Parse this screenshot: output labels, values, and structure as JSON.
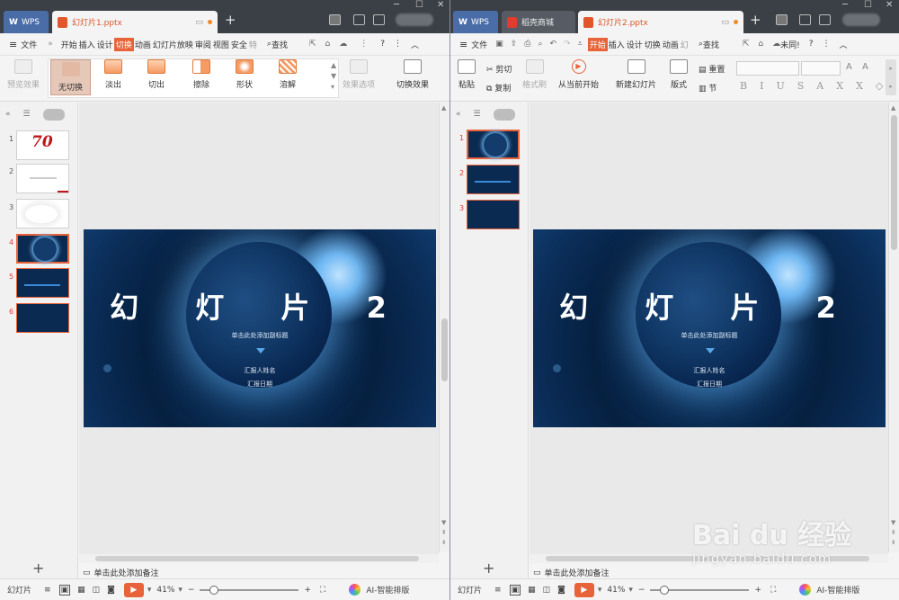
{
  "left_window": {
    "tabs": {
      "wps": "WPS",
      "file": "幻灯片1.pptx"
    },
    "menu": {
      "file": "文件",
      "items": [
        "开始",
        "插入",
        "设计",
        "切换",
        "动画",
        "幻灯片放映",
        "审阅",
        "视图",
        "安全",
        "特"
      ],
      "active": "切换",
      "search": "查找"
    },
    "ribbon": {
      "preview": "预览效果",
      "transitions": [
        "无切换",
        "淡出",
        "切出",
        "擦除",
        "形状",
        "溶解"
      ],
      "effect_options": "效果选项",
      "switch_effect": "切换效果"
    },
    "thumbnails": [
      "1",
      "2",
      "3",
      "4",
      "5",
      "6"
    ],
    "selected_thumbnail": "4",
    "slide": {
      "title": "幻 灯 片 2",
      "subtitle": "单击此处添加副标题",
      "reporter": "汇报人姓名",
      "date": "汇报日期"
    },
    "notes": "单击此处添加备注",
    "status": {
      "label": "幻灯片",
      "zoom": "41%",
      "zoom_fraction": 0.14,
      "ai": "AI-智能排版"
    }
  },
  "right_window": {
    "tabs": {
      "wps": "WPS",
      "store": "稻壳商城",
      "file": "幻灯片2.pptx"
    },
    "menu": {
      "file": "文件",
      "items": [
        "开始",
        "插入",
        "设计",
        "切换",
        "动画",
        "幻"
      ],
      "active": "开始",
      "search": "查找",
      "sync": "未同!"
    },
    "ribbon": {
      "paste": "粘贴",
      "cut": "剪切",
      "copy": "复制",
      "format_painter": "格式刷",
      "play_from_current": "从当前开始",
      "new_slide": "新建幻灯片",
      "layout": "版式",
      "reset": "重置",
      "section": "节"
    },
    "thumbnails": [
      "1",
      "2",
      "3"
    ],
    "selected_thumbnail": "1",
    "slide": {
      "title": "幻 灯 片 2",
      "subtitle": "单击此处添加副标题",
      "reporter": "汇报人姓名",
      "date": "汇报日期"
    },
    "notes": "单击此处添加备注",
    "status": {
      "label": "幻灯片",
      "zoom": "41%",
      "zoom_fraction": 0.14,
      "ai": "AI-智能排版"
    }
  },
  "watermark": {
    "brand": "Bai du 经验",
    "url": "jingyan.baidu.com"
  },
  "colors": {
    "accent": "#e8633a",
    "titlebar": "#3b3f46",
    "wps_tab": "#4a6da8"
  }
}
